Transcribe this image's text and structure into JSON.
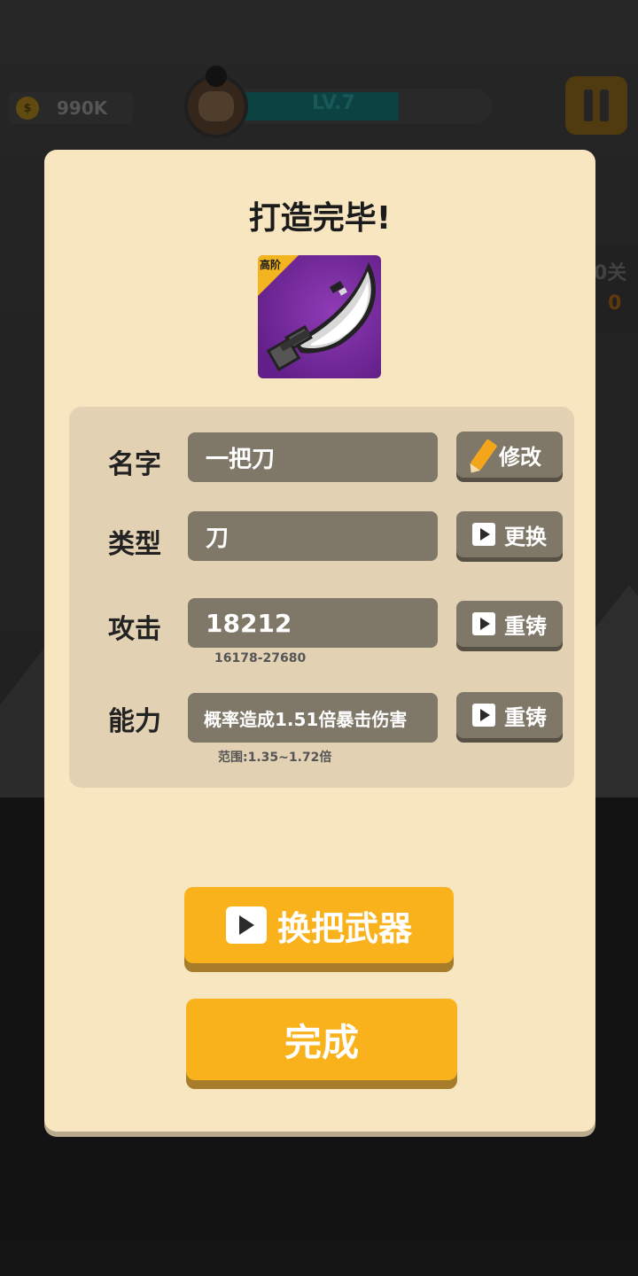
{
  "hud": {
    "coins": "990K",
    "level": "LV.7",
    "stage_label_partial": "0关",
    "stage_count_partial": "0"
  },
  "dialog": {
    "title": "打造完毕!",
    "weapon": {
      "tier": "高阶",
      "icon": "curved-blade-icon"
    },
    "rows": [
      {
        "label": "名字",
        "value": "一把刀",
        "action": "修改",
        "action_icon": "pencil-icon"
      },
      {
        "label": "类型",
        "value": "刀",
        "action": "更换",
        "action_icon": "video-play-icon"
      },
      {
        "label": "攻击",
        "value": "18212",
        "range": "16178-27680",
        "action": "重铸",
        "action_icon": "video-play-icon"
      },
      {
        "label": "能力",
        "value": "概率造成1.51倍暴击伤害",
        "range": "范围:1.35~1.72倍",
        "action": "重铸",
        "action_icon": "video-play-icon"
      }
    ],
    "swap_weapon_button": "换把武器",
    "done_button": "完成"
  },
  "colors": {
    "dialog_bg": "#f8e6c1",
    "panel_bg": "#e2d2b3",
    "value_box": "#7f7767",
    "accent_orange": "#f9b21b",
    "tier_gold": "#f3b51f",
    "weapon_purple": "#7a2ea0"
  }
}
